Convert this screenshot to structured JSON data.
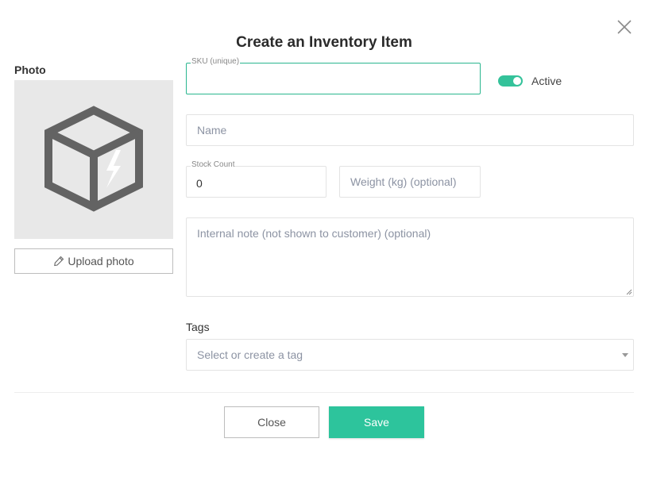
{
  "dialog": {
    "title": "Create an Inventory Item",
    "close_icon": "close-icon"
  },
  "photo": {
    "label": "Photo",
    "placeholder_icon": "box-icon",
    "upload_label": "Upload photo",
    "upload_icon": "pencil-icon"
  },
  "form": {
    "sku": {
      "label": "SKU (unique)",
      "value": ""
    },
    "active": {
      "label": "Active",
      "on": true
    },
    "name": {
      "placeholder": "Name",
      "value": ""
    },
    "stock": {
      "label": "Stock Count",
      "value": "0"
    },
    "weight": {
      "placeholder": "Weight (kg) (optional)",
      "value": ""
    },
    "note": {
      "placeholder": "Internal note (not shown to customer) (optional)",
      "value": ""
    },
    "tags": {
      "label": "Tags",
      "placeholder": "Select or create a tag"
    }
  },
  "actions": {
    "close_label": "Close",
    "save_label": "Save"
  },
  "colors": {
    "accent": "#2dc49c",
    "photo_bg": "#e8e8e8",
    "box_icon": "#666666"
  }
}
